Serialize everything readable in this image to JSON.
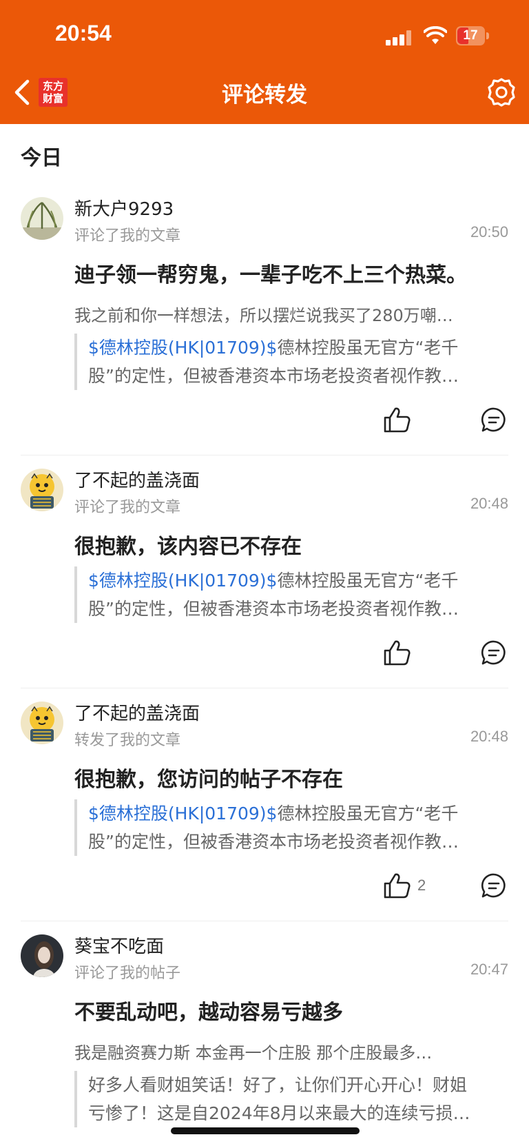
{
  "status_bar": {
    "time": "20:54",
    "battery": "17"
  },
  "nav": {
    "logo_line1": "东方",
    "logo_line2": "财富",
    "title": "评论转发"
  },
  "section": {
    "title": "今日"
  },
  "items": [
    {
      "user": "新大户9293",
      "action": "评论了我的文章",
      "time": "20:50",
      "title": "迪子领一帮穷鬼，一辈子吃不上三个热菜。",
      "excerpt": "我之前和你一样想法，所以摆烂说我买了280万嘲…",
      "quote_link": "$德林控股(HK|01709)$",
      "quote_line1": "德林控股虽无官方“老千",
      "quote_line2": "股”的定性，但被香港资本市场老投资者视作教…",
      "likes": ""
    },
    {
      "user": "了不起的盖浇面",
      "action": "评论了我的文章",
      "time": "20:48",
      "title": "很抱歉，该内容已不存在",
      "quote_link": "$德林控股(HK|01709)$",
      "quote_line1": "德林控股虽无官方“老千",
      "quote_line2": "股”的定性，但被香港资本市场老投资者视作教…",
      "likes": ""
    },
    {
      "user": "了不起的盖浇面",
      "action": "转发了我的文章",
      "time": "20:48",
      "title": "很抱歉，您访问的帖子不存在",
      "quote_link": "$德林控股(HK|01709)$",
      "quote_line1": "德林控股虽无官方“老千",
      "quote_line2": "股”的定性，但被香港资本市场老投资者视作教…",
      "likes": "2"
    },
    {
      "user": "葵宝不吃面",
      "action": "评论了我的帖子",
      "time": "20:47",
      "title": "不要乱动吧，越动容易亏越多",
      "excerpt": "我是融资赛力斯 本金再一个庄股  那个庄股最多…",
      "quote_line1": "好多人看财姐笑话！好了，让你们开心开心！财姐",
      "quote_line2": "亏惨了！这是自2024年8月以来最大的连续亏损…"
    }
  ]
}
